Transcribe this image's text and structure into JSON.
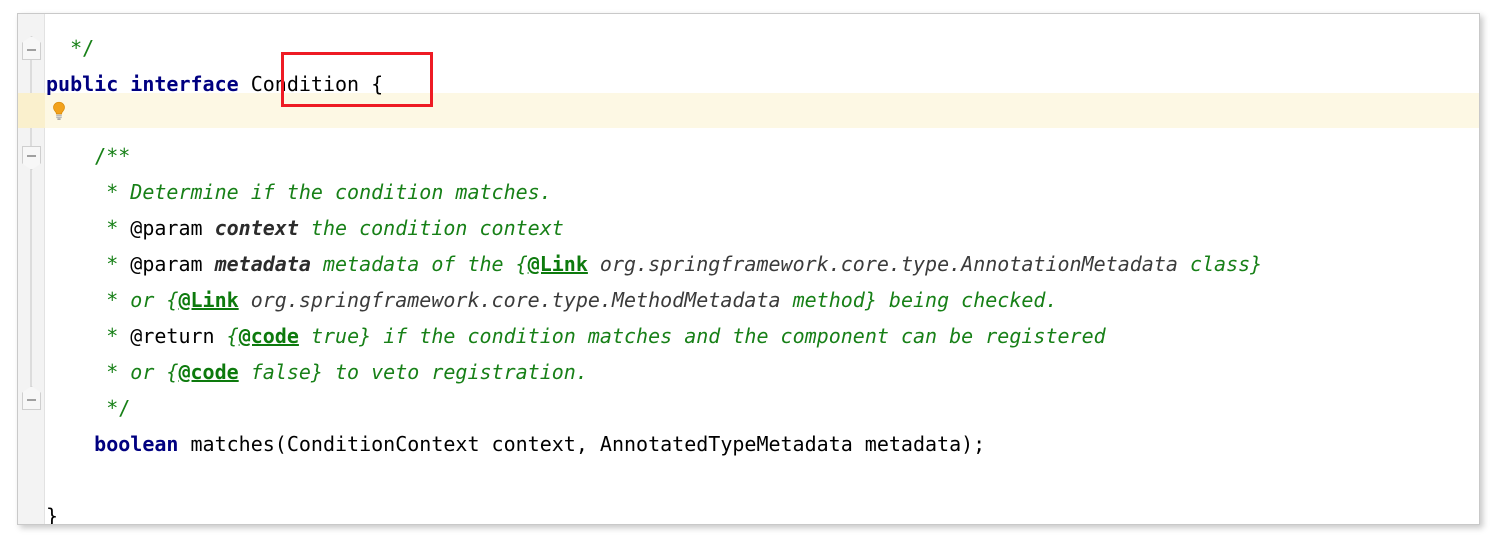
{
  "editor": {
    "language": "java",
    "theme": "light",
    "colors": {
      "keyword": "#000080",
      "comment_green": "#178017",
      "javadoc_tag": "#0d7a0d",
      "javadoc_param": "#2c2c2c",
      "javadoc_reference": "#3b3b3b",
      "plain_text": "#000000",
      "caret_line_background": "#fdf8e4",
      "gutter_background": "#f3f3f3",
      "annotation_red": "#ee1b24",
      "bulb_amber": "#f2a21c"
    },
    "gutter": {
      "fold_markers": [
        {
          "name": "fold-end-marker-top",
          "type": "fold-end",
          "symbol": "-"
        },
        {
          "name": "fold-start-marker-javadoc",
          "type": "fold-start",
          "symbol": "-"
        },
        {
          "name": "fold-end-marker-javadoc",
          "type": "fold-end",
          "symbol": "-"
        }
      ]
    },
    "intention_bulb": {
      "icon": "lightbulb-icon",
      "tooltip": "Show Context Actions"
    },
    "annotation": {
      "shape": "rectangle",
      "color": "#ee1b24",
      "target_text": "Condition"
    },
    "lines": [
      {
        "number": 1,
        "name": "line-comment-close",
        "tokens": [
          {
            "style": "cmt-nb",
            "text": "  */"
          }
        ]
      },
      {
        "number": 2,
        "name": "line-interface-declaration",
        "tokens": [
          {
            "style": "kw",
            "text": "public interface"
          },
          {
            "style": "plain",
            "text": " Condition {"
          }
        ]
      },
      {
        "number": 3,
        "name": "line-blank-caret",
        "tokens": []
      },
      {
        "number": 4,
        "name": "line-javadoc-open",
        "tokens": [
          {
            "style": "cmt-nb",
            "text": "    /**"
          }
        ]
      },
      {
        "number": 5,
        "name": "line-javadoc-description",
        "tokens": [
          {
            "style": "cmt-nb",
            "text": "     * "
          },
          {
            "style": "cmt",
            "text": "Determine if the condition matches."
          }
        ]
      },
      {
        "number": 6,
        "name": "line-javadoc-param-context",
        "tokens": [
          {
            "style": "cmt-nb",
            "text": "     * "
          },
          {
            "style": "jd-tag",
            "text": "@param"
          },
          {
            "style": "cmt",
            "text": " "
          },
          {
            "style": "jd-param",
            "text": "context"
          },
          {
            "style": "cmt",
            "text": " the condition context"
          }
        ]
      },
      {
        "number": 7,
        "name": "line-javadoc-param-metadata",
        "tokens": [
          {
            "style": "cmt-nb",
            "text": "     * "
          },
          {
            "style": "jd-tag",
            "text": "@param"
          },
          {
            "style": "cmt",
            "text": " "
          },
          {
            "style": "jd-param",
            "text": "metadata"
          },
          {
            "style": "cmt",
            "text": " metadata of the "
          },
          {
            "style": "jd-brace",
            "text": "{"
          },
          {
            "style": "jd-tag-u",
            "text": "@Link"
          },
          {
            "style": "jd-ref",
            "text": " org.springframework.core.type.AnnotationMetadata "
          },
          {
            "style": "cmt",
            "text": "class}"
          }
        ]
      },
      {
        "number": 8,
        "name": "line-javadoc-link-methodmetadata",
        "tokens": [
          {
            "style": "cmt-nb",
            "text": "     * "
          },
          {
            "style": "cmt",
            "text": "or "
          },
          {
            "style": "jd-brace",
            "text": "{"
          },
          {
            "style": "jd-tag-u",
            "text": "@Link"
          },
          {
            "style": "jd-ref",
            "text": " org.springframework.core.type.MethodMetadata "
          },
          {
            "style": "cmt",
            "text": "method} being checked."
          }
        ]
      },
      {
        "number": 9,
        "name": "line-javadoc-return",
        "tokens": [
          {
            "style": "cmt-nb",
            "text": "     * "
          },
          {
            "style": "jd-tag",
            "text": "@return"
          },
          {
            "style": "cmt",
            "text": " {"
          },
          {
            "style": "jd-tag-u",
            "text": "@code"
          },
          {
            "style": "cmt",
            "text": " true} if the condition matches and the component can be registered"
          }
        ]
      },
      {
        "number": 10,
        "name": "line-javadoc-return-continued",
        "tokens": [
          {
            "style": "cmt-nb",
            "text": "     * "
          },
          {
            "style": "cmt",
            "text": "or {"
          },
          {
            "style": "jd-tag-u",
            "text": "@code"
          },
          {
            "style": "cmt",
            "text": " false} to veto registration."
          }
        ]
      },
      {
        "number": 11,
        "name": "line-javadoc-close",
        "tokens": [
          {
            "style": "cmt-nb",
            "text": "     */"
          }
        ]
      },
      {
        "number": 12,
        "name": "line-method-signature",
        "tokens": [
          {
            "style": "plain",
            "text": "    "
          },
          {
            "style": "kw",
            "text": "boolean"
          },
          {
            "style": "plain",
            "text": " matches(ConditionContext context, AnnotatedTypeMetadata metadata);"
          }
        ]
      },
      {
        "number": 13,
        "name": "line-blank-after-method",
        "tokens": []
      },
      {
        "number": 14,
        "name": "line-interface-close",
        "tokens": [
          {
            "style": "plain",
            "text": "}"
          }
        ]
      }
    ]
  }
}
